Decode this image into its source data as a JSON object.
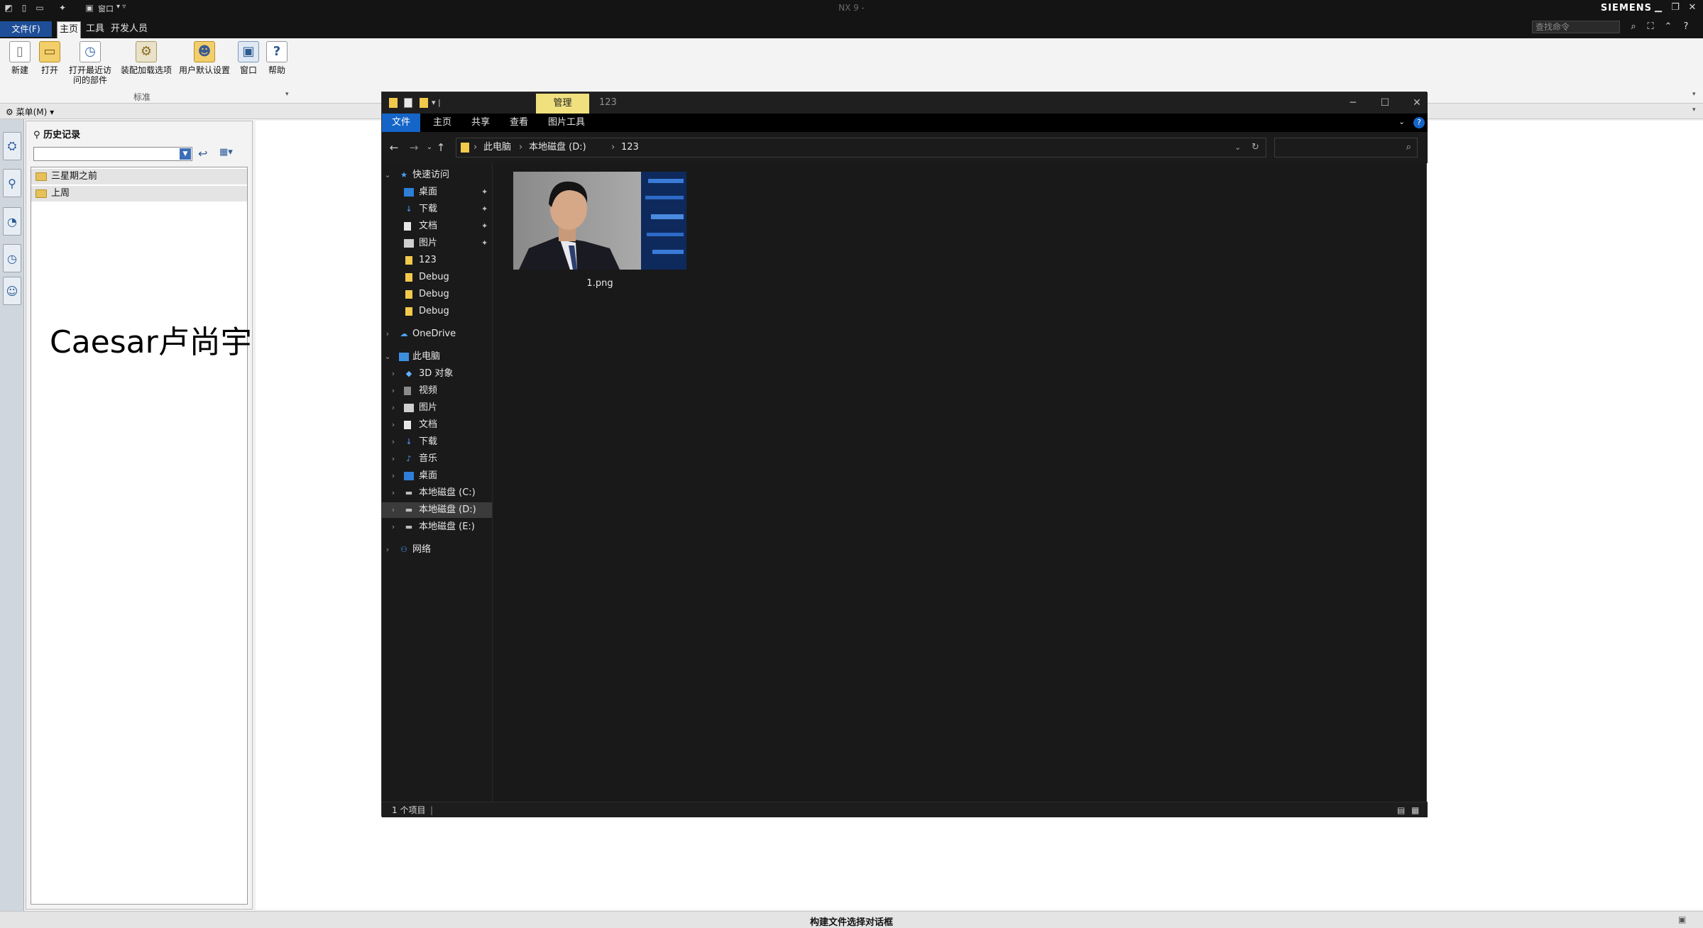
{
  "nx": {
    "title": "NX 9 -",
    "brand": "SIEMENS",
    "window_menu_label": "窗口",
    "menu": {
      "file": "文件(F)",
      "tabs": [
        "主页",
        "工具",
        "开发人员"
      ]
    },
    "find_placeholder": "查找命令",
    "ribbon": {
      "buttons": [
        {
          "label": "新建",
          "icon": "new-file-icon"
        },
        {
          "label": "打开",
          "icon": "open-folder-icon"
        },
        {
          "label": "打开最近访问的部件",
          "icon": "recent-parts-icon"
        },
        {
          "label": "装配加载选项",
          "icon": "assembly-load-icon"
        },
        {
          "label": "用户默认设置",
          "icon": "user-defaults-icon"
        },
        {
          "label": "窗口",
          "icon": "window-icon"
        },
        {
          "label": "帮助",
          "icon": "help-icon"
        }
      ],
      "group_label": "标准"
    },
    "menu_button": "菜单(M)",
    "history": {
      "title": "历史记录",
      "groups": [
        "三星期之前",
        "上周"
      ]
    },
    "status": "构建文件选择对话框"
  },
  "overlay_text": "Caesar卢尚宇",
  "explorer": {
    "context_tab": "管理",
    "window_title": "123",
    "ribbon_tabs": [
      "文件",
      "主页",
      "共享",
      "查看",
      "图片工具"
    ],
    "breadcrumb": [
      "此电脑",
      "本地磁盘 (D:)",
      "123"
    ],
    "nav": {
      "quick_access": "快速访问",
      "quick_items": [
        {
          "label": "桌面",
          "icon": "desktop-icon",
          "pinned": true
        },
        {
          "label": "下载",
          "icon": "download-icon",
          "pinned": true
        },
        {
          "label": "文档",
          "icon": "documents-icon",
          "pinned": true
        },
        {
          "label": "图片",
          "icon": "pictures-icon",
          "pinned": true
        },
        {
          "label": "123",
          "icon": "folder-icon",
          "pinned": false
        },
        {
          "label": "Debug",
          "icon": "folder-icon",
          "pinned": false
        },
        {
          "label": "Debug",
          "icon": "folder-icon",
          "pinned": false
        },
        {
          "label": "Debug",
          "icon": "folder-icon",
          "pinned": false
        }
      ],
      "onedrive": "OneDrive",
      "this_pc": "此电脑",
      "pc_items": [
        {
          "label": "3D 对象",
          "icon": "3d-objects-icon"
        },
        {
          "label": "视频",
          "icon": "videos-icon"
        },
        {
          "label": "图片",
          "icon": "pictures-icon"
        },
        {
          "label": "文档",
          "icon": "documents-icon"
        },
        {
          "label": "下载",
          "icon": "download-icon"
        },
        {
          "label": "音乐",
          "icon": "music-icon"
        },
        {
          "label": "桌面",
          "icon": "desktop-icon"
        },
        {
          "label": "本地磁盘 (C:)",
          "icon": "drive-icon"
        },
        {
          "label": "本地磁盘 (D:)",
          "icon": "drive-icon",
          "selected": true
        },
        {
          "label": "本地磁盘 (E:)",
          "icon": "drive-icon"
        }
      ],
      "network": "网络"
    },
    "files": [
      {
        "name": "1.png",
        "type": "image"
      }
    ],
    "status": "1 个项目",
    "colors": {
      "accent": "#1565c8",
      "manage_tab": "#f0e07e",
      "background": "#191919",
      "folder": "#f2c94c"
    }
  }
}
